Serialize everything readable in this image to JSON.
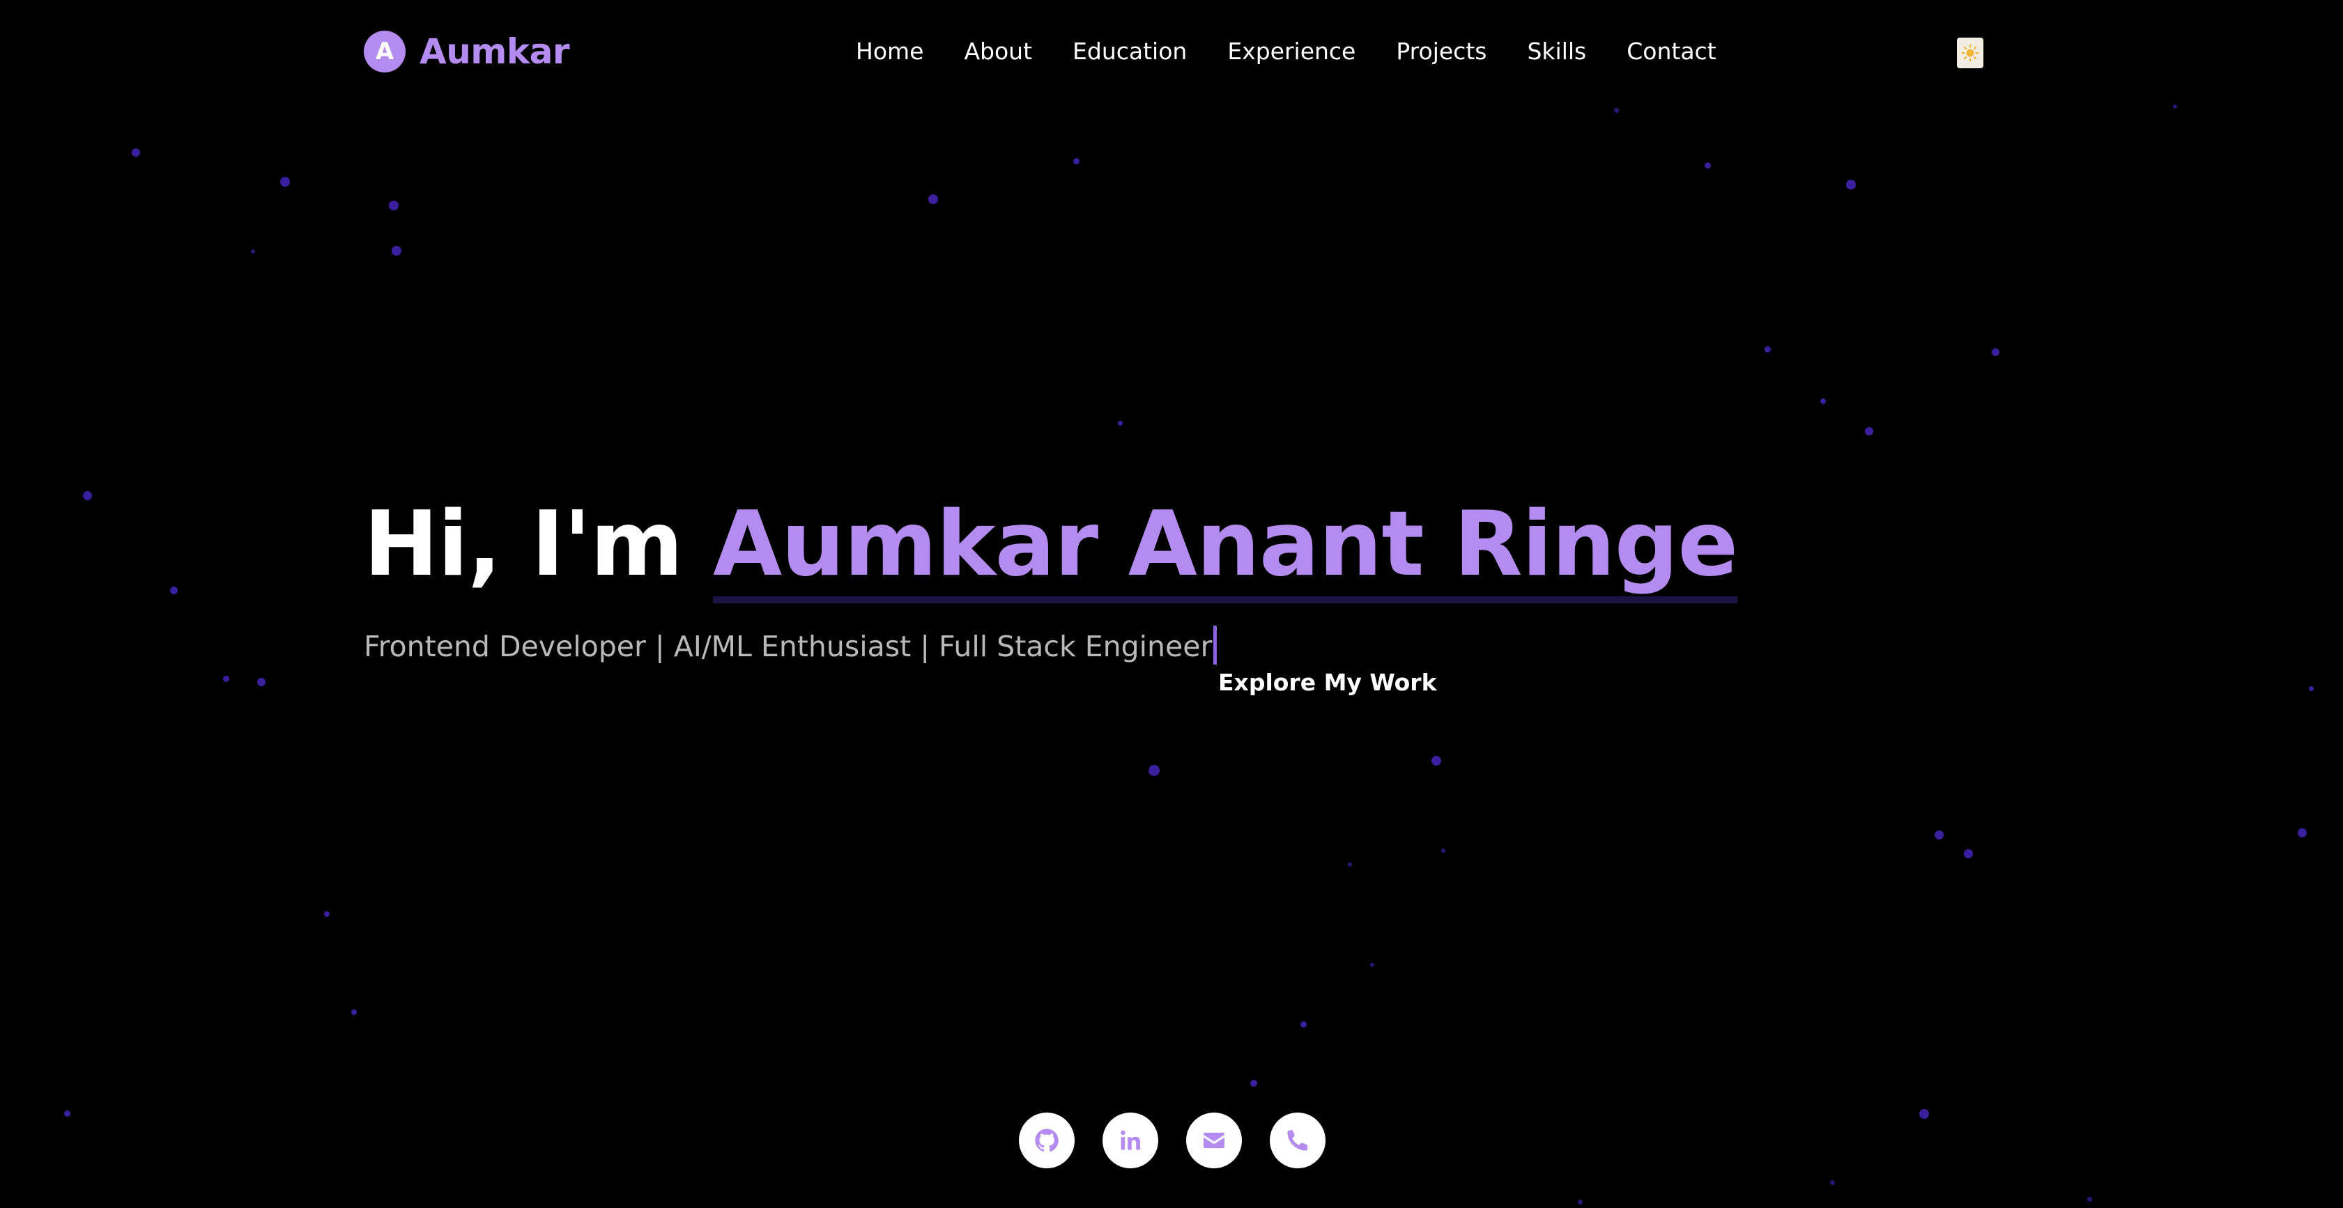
{
  "brand": {
    "badge_letter": "A",
    "name": "Aumkar"
  },
  "nav": {
    "items": [
      {
        "label": "Home"
      },
      {
        "label": "About"
      },
      {
        "label": "Education"
      },
      {
        "label": "Experience"
      },
      {
        "label": "Projects"
      },
      {
        "label": "Skills"
      },
      {
        "label": "Contact"
      }
    ],
    "theme_toggle_icon": "sun-icon"
  },
  "hero": {
    "greeting": "Hi, I'm ",
    "name": "Aumkar Anant Ringe",
    "subtitle": "Frontend Developer | AI/ML Enthusiast | Full Stack Engineer",
    "cta_label": "Explore My Work"
  },
  "socials": [
    {
      "icon": "github-icon"
    },
    {
      "icon": "linkedin-icon"
    },
    {
      "icon": "email-icon"
    },
    {
      "icon": "phone-icon"
    }
  ],
  "colors": {
    "background": "#000000",
    "accent": "#b48cf0",
    "particle": "#3a1f9e",
    "subtitle": "#b9b9b9"
  }
}
